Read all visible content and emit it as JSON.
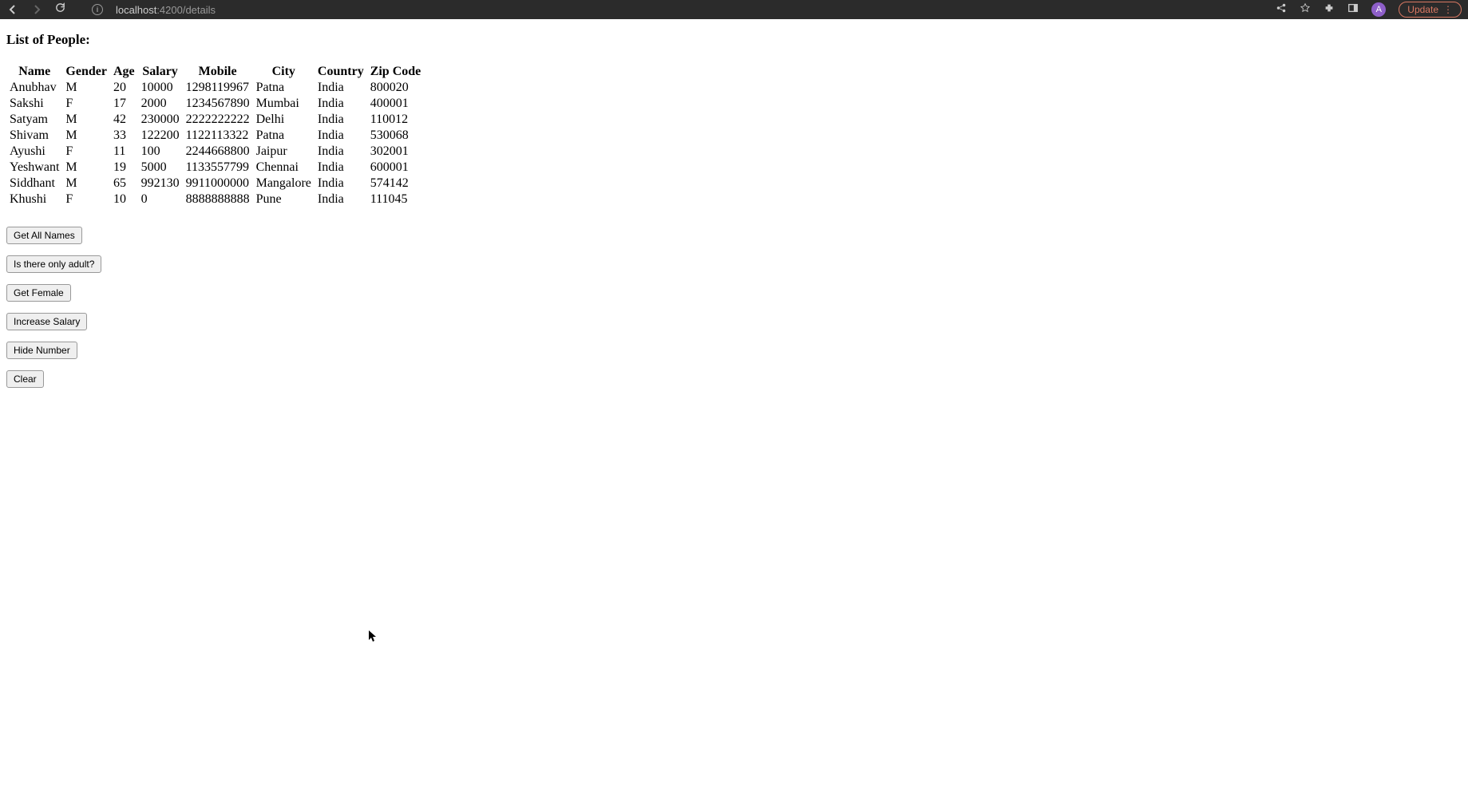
{
  "browser": {
    "url_host": "localhost",
    "url_path": ":4200/details",
    "avatar_letter": "A",
    "update_label": "Update"
  },
  "page_title": "List of People:",
  "headers": [
    "Name",
    "Gender",
    "Age",
    "Salary",
    "Mobile",
    "City",
    "Country",
    "Zip Code"
  ],
  "rows": [
    {
      "name": "Anubhav",
      "gender": "M",
      "age": "20",
      "salary": "10000",
      "mobile": "1298119967",
      "city": "Patna",
      "country": "India",
      "zip": "800020"
    },
    {
      "name": "Sakshi",
      "gender": "F",
      "age": "17",
      "salary": "2000",
      "mobile": "1234567890",
      "city": "Mumbai",
      "country": "India",
      "zip": "400001"
    },
    {
      "name": "Satyam",
      "gender": "M",
      "age": "42",
      "salary": "230000",
      "mobile": "2222222222",
      "city": "Delhi",
      "country": "India",
      "zip": "110012"
    },
    {
      "name": "Shivam",
      "gender": "M",
      "age": "33",
      "salary": "122200",
      "mobile": "1122113322",
      "city": "Patna",
      "country": "India",
      "zip": "530068"
    },
    {
      "name": "Ayushi",
      "gender": "F",
      "age": "11",
      "salary": "100",
      "mobile": "2244668800",
      "city": "Jaipur",
      "country": "India",
      "zip": "302001"
    },
    {
      "name": "Yeshwant",
      "gender": "M",
      "age": "19",
      "salary": "5000",
      "mobile": "1133557799",
      "city": "Chennai",
      "country": "India",
      "zip": "600001"
    },
    {
      "name": "Siddhant",
      "gender": "M",
      "age": "65",
      "salary": "992130",
      "mobile": "9911000000",
      "city": "Mangalore",
      "country": "India",
      "zip": "574142"
    },
    {
      "name": "Khushi",
      "gender": "F",
      "age": "10",
      "salary": "0",
      "mobile": "8888888888",
      "city": "Pune",
      "country": "India",
      "zip": "111045"
    }
  ],
  "buttons": {
    "get_all_names": "Get All Names",
    "only_adult": "Is there only adult?",
    "get_female": "Get Female",
    "increase_salary": "Increase Salary",
    "hide_number": "Hide Number",
    "clear": "Clear"
  }
}
